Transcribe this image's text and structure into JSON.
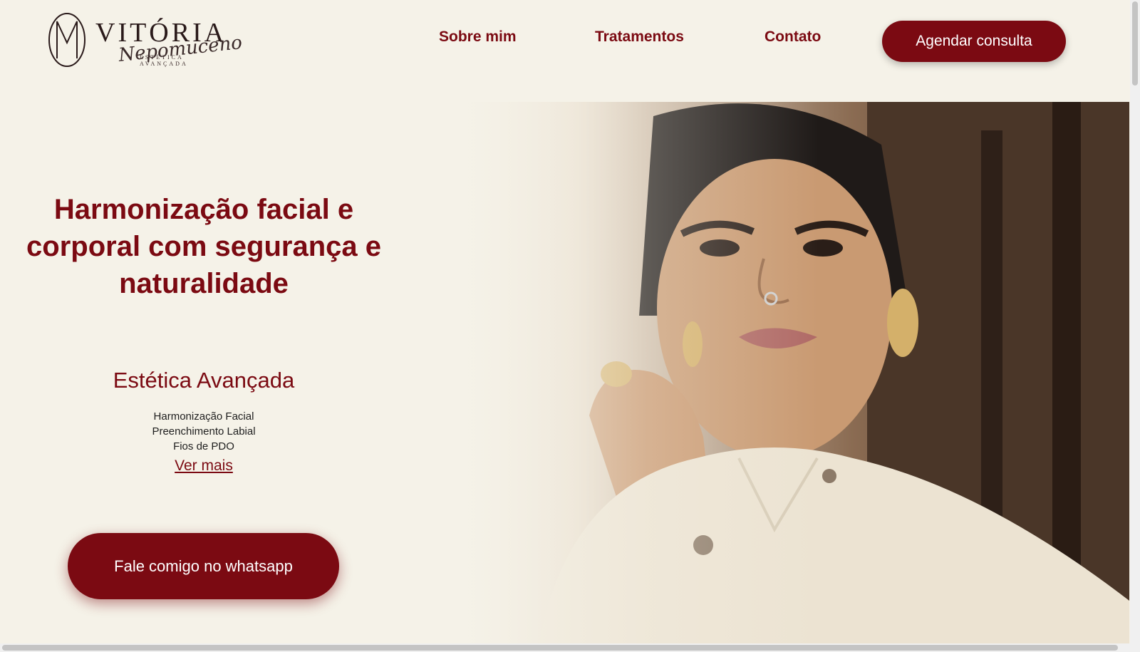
{
  "brand": {
    "name": "VITÓRIA",
    "script": "Nepomuceno",
    "subtitle": "ESTÉTICA AVANÇADA",
    "logo_icon": "monogram-m-icon"
  },
  "nav": {
    "items": [
      "Sobre mim",
      "Tratamentos",
      "Contato"
    ],
    "cta": "Agendar consulta"
  },
  "hero": {
    "headline": "Harmonização facial e corporal com segurança e naturalidade",
    "subheading": "Estética Avançada",
    "services": [
      "Harmonização Facial",
      "Preenchimento Labial",
      "Fios de PDO"
    ],
    "more_link": "Ver mais",
    "whatsapp_cta": "Fale comigo no whatsapp",
    "photo": "portrait-photo"
  },
  "colors": {
    "accent": "#7b0a12",
    "background": "#f5f2e8",
    "text": "#1e1e1e"
  }
}
